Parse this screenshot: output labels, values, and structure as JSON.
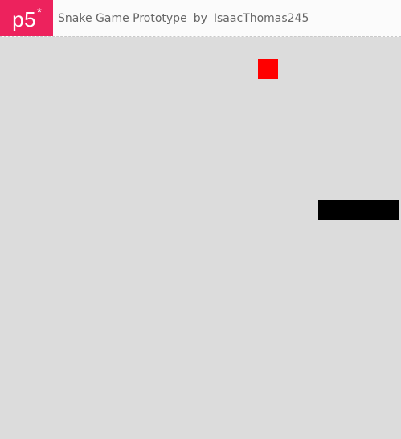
{
  "header": {
    "logo_text": "p5",
    "logo_star": "*",
    "title": "Snake Game Prototype",
    "by_label": "by",
    "author": "IsaacThomas245"
  },
  "colors": {
    "brand": "#ed225d",
    "canvas_background": "#dcdcdc",
    "food": "#ff0000",
    "snake": "#000000"
  },
  "game": {
    "food_icon": "food-square",
    "snake_icon": "snake-body"
  }
}
